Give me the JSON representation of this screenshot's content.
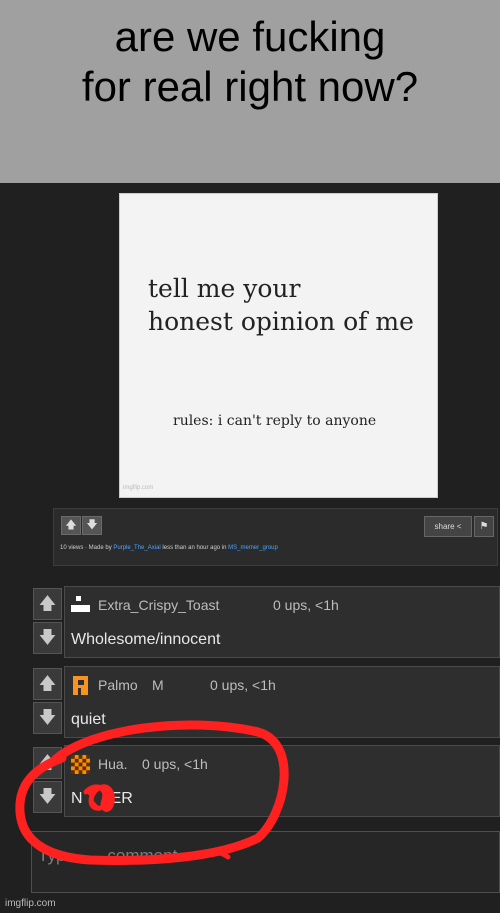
{
  "caption": {
    "line1": "are we fucking",
    "line2": "for real right now?"
  },
  "meme": {
    "line1": "tell me your",
    "line2": "honest opinion of me",
    "rules": "rules: i can't reply to anyone",
    "watermark": "imgflip.com"
  },
  "post_actions": {
    "upvote": "🡅",
    "downvote": "🡇",
    "share_label": "share",
    "share_icon": "share-icon",
    "flag_icon": "flag-icon",
    "views": "10 views · Made by",
    "author": "Purple_The_Axial",
    "time_text": "less than an hour ago in",
    "stream": "MS_memer_group"
  },
  "comments": [
    {
      "username": "Extra_Crispy_Toast",
      "stats": "0 ups, <1h",
      "text": "Wholesome/innocent",
      "avatar_color": "#ffffff"
    },
    {
      "username": "Palmo",
      "badge": "M",
      "stats": "0 ups, <1h",
      "text": "quiet",
      "avatar_color": "#f7931e"
    },
    {
      "username": "Hua.",
      "stats": "0 ups, <1h",
      "text_start": "N",
      "text_end": "ER",
      "avatar_color": "#ff8c00"
    }
  ],
  "comment_input": {
    "placeholder_start": "Typ",
    "placeholder_end": "comment"
  },
  "watermark": "imgflip.com",
  "colors": {
    "circle": "#ff2020",
    "link": "#4ea3ff"
  }
}
